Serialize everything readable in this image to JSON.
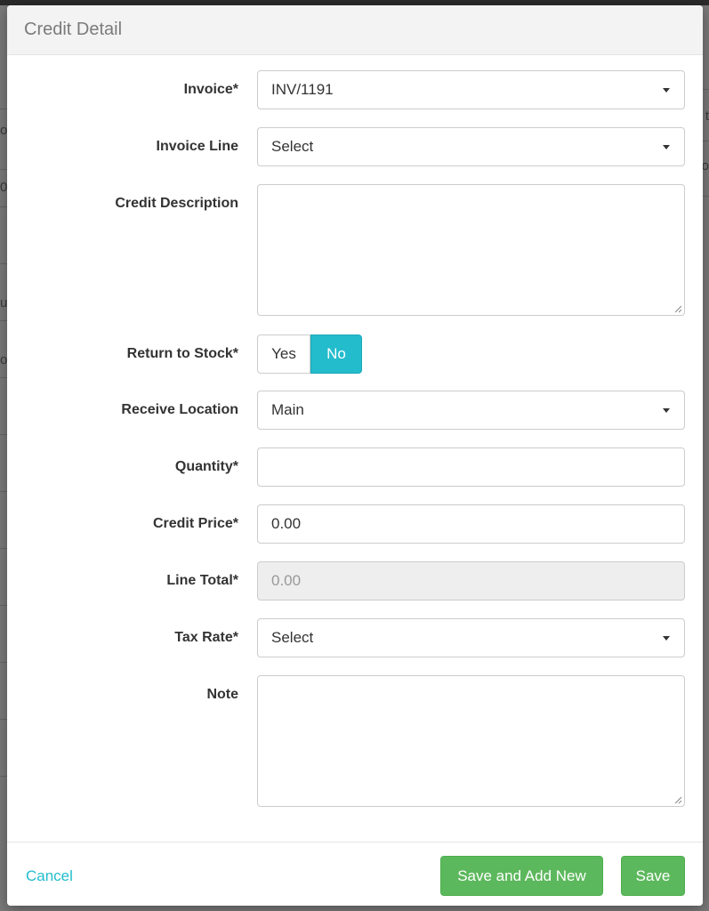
{
  "modal": {
    "title": "Credit Detail"
  },
  "backdrop": {
    "fragments_left": [
      "os",
      "0",
      "u",
      "or"
    ],
    "fragments_right": [
      "t",
      "o"
    ]
  },
  "form": {
    "invoice": {
      "label": "Invoice*",
      "value": "INV/1191"
    },
    "invoice_line": {
      "label": "Invoice Line",
      "value": "Select"
    },
    "credit_description": {
      "label": "Credit Description",
      "value": ""
    },
    "return_to_stock": {
      "label": "Return to Stock*",
      "options": [
        "Yes",
        "No"
      ],
      "selected": "No"
    },
    "receive_location": {
      "label": "Receive Location",
      "value": "Main"
    },
    "quantity": {
      "label": "Quantity*",
      "value": ""
    },
    "credit_price": {
      "label": "Credit Price*",
      "value": "0.00"
    },
    "line_total": {
      "label": "Line Total*",
      "value": "0.00"
    },
    "tax_rate": {
      "label": "Tax Rate*",
      "value": "Select"
    },
    "note": {
      "label": "Note",
      "value": ""
    }
  },
  "footer": {
    "cancel_label": "Cancel",
    "save_add_new_label": "Save and Add New",
    "save_label": "Save"
  },
  "colors": {
    "accent": "#23bccd",
    "button_green": "#5cb85c"
  }
}
